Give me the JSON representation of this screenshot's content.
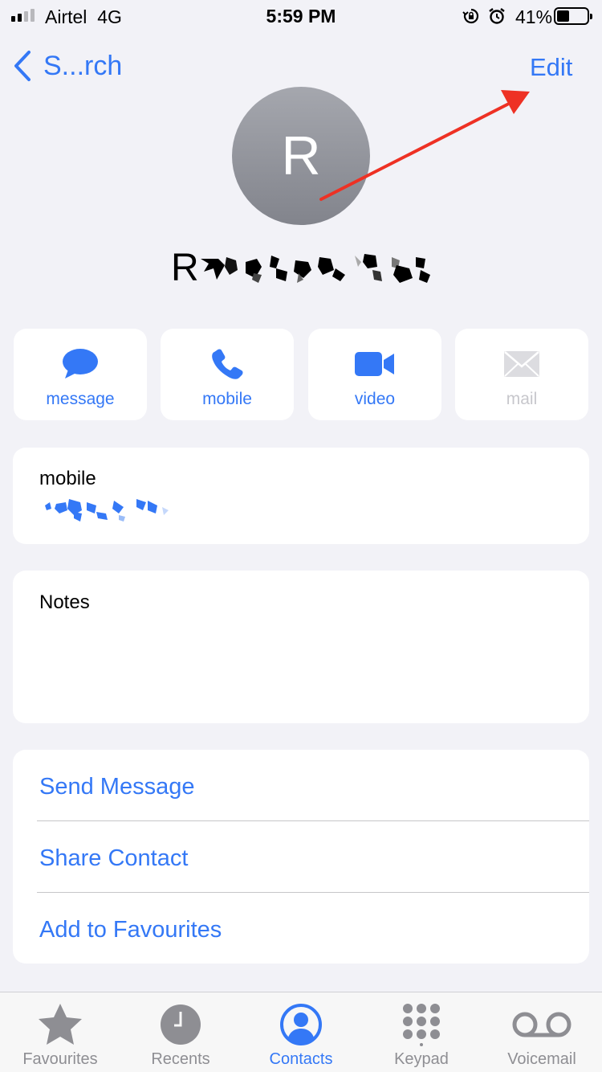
{
  "status_bar": {
    "carrier": "Airtel",
    "network": "4G",
    "time": "5:59 PM",
    "battery_percent": "41%",
    "battery_level": 0.41,
    "icons": [
      "signal-icon",
      "orientation-lock-icon",
      "alarm-icon",
      "battery-icon"
    ]
  },
  "nav": {
    "back_label": "S...rch",
    "edit_label": "Edit"
  },
  "contact": {
    "initial": "R",
    "name_visible_prefix": "R"
  },
  "actions": [
    {
      "label": "message",
      "icon": "message-bubble-icon",
      "enabled": true
    },
    {
      "label": "mobile",
      "icon": "phone-icon",
      "enabled": true
    },
    {
      "label": "video",
      "icon": "video-camera-icon",
      "enabled": true
    },
    {
      "label": "mail",
      "icon": "envelope-icon",
      "enabled": false
    }
  ],
  "phone_card": {
    "label": "mobile"
  },
  "notes_card": {
    "label": "Notes"
  },
  "options": [
    {
      "label": "Send Message"
    },
    {
      "label": "Share Contact"
    },
    {
      "label": "Add to Favourites"
    }
  ],
  "tabs": [
    {
      "label": "Favourites",
      "icon": "star-icon",
      "active": false
    },
    {
      "label": "Recents",
      "icon": "clock-icon",
      "active": false
    },
    {
      "label": "Contacts",
      "icon": "person-circle-icon",
      "active": true
    },
    {
      "label": "Keypad",
      "icon": "keypad-icon",
      "active": false
    },
    {
      "label": "Voicemail",
      "icon": "voicemail-icon",
      "active": false
    }
  ],
  "colors": {
    "accent": "#3478f6",
    "background": "#f2f2f7",
    "annotation_arrow": "#ee3124"
  }
}
